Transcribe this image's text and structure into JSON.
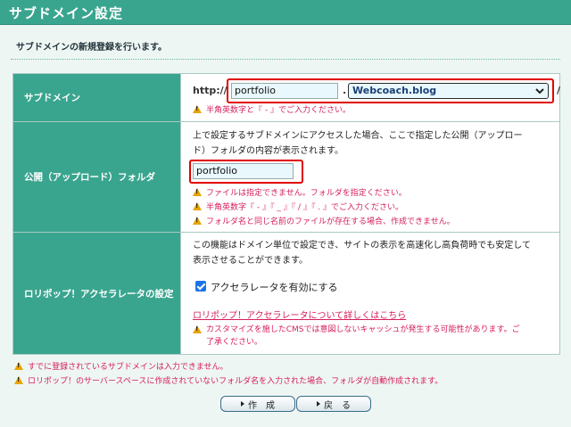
{
  "page": {
    "title": "サブドメイン設定",
    "subtitle": "サブドメインの新規登録を行います。"
  },
  "subdomain": {
    "label": "サブドメイン",
    "scheme": "http://",
    "value": "portfolio",
    "dot": ".",
    "domain_selected": "Webcoach.blog",
    "slash": "/",
    "warning": "半角英数字と『 - 』でご入力ください。"
  },
  "folder": {
    "label": "公開（アップロード）フォルダ",
    "description_line1": "上で設定するサブドメインにアクセスした場合、ここで指定した公開（アップロー",
    "description_line2": "ド）フォルダの内容が表示されます。",
    "value": "portfolio",
    "warnings": [
      "ファイルは指定できません。フォルダを指定ください。",
      "半角英数字『 - 』『 _ 』『 / 』『 . 』でご入力ください。",
      "フォルダ名と同じ名前のファイルが存在する場合、作成できません。"
    ]
  },
  "accelerator": {
    "label": "ロリポップ！アクセラレータの設定",
    "description_line1": "この機能はドメイン単位で設定でき、サイトの表示を高速化し高負荷時でも安定して",
    "description_line2": "表示させることができます。",
    "checkbox_label": "アクセラレータを有効にする",
    "checked": true,
    "link_text": "ロリポップ！アクセラレータについて詳しくはこちら",
    "warning_line1": "カスタマイズを施したCMSでは意図しないキャッシュが発生する可能性があります。ご",
    "warning_line2": "了承ください。"
  },
  "notes": [
    "すでに登録されているサブドメインは入力できません。",
    "ロリポップ！のサーバースペースに作成されていないフォルダ名を入力された場合、フォルダが自動作成されます。"
  ],
  "buttons": {
    "create": "作　成",
    "back": "戻　る"
  },
  "colors": {
    "header": "#3aa58f",
    "warning_text": "#d5205a",
    "highlight_box": "#e00000"
  }
}
